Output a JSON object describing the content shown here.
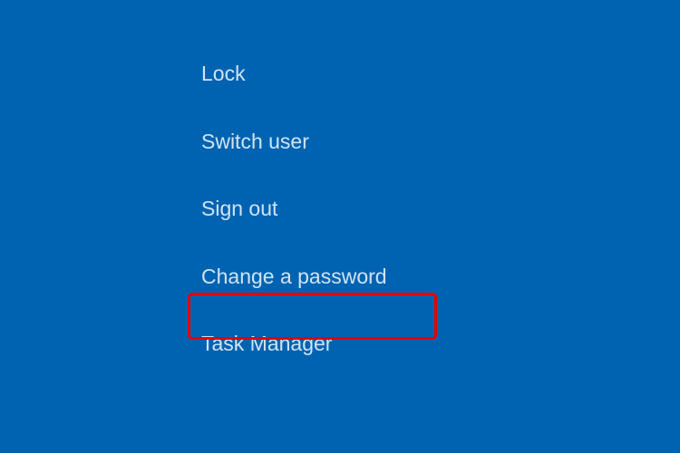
{
  "menu": {
    "items": [
      {
        "label": "Lock"
      },
      {
        "label": "Switch user"
      },
      {
        "label": "Sign out"
      },
      {
        "label": "Change a password"
      },
      {
        "label": "Task Manager"
      }
    ]
  }
}
